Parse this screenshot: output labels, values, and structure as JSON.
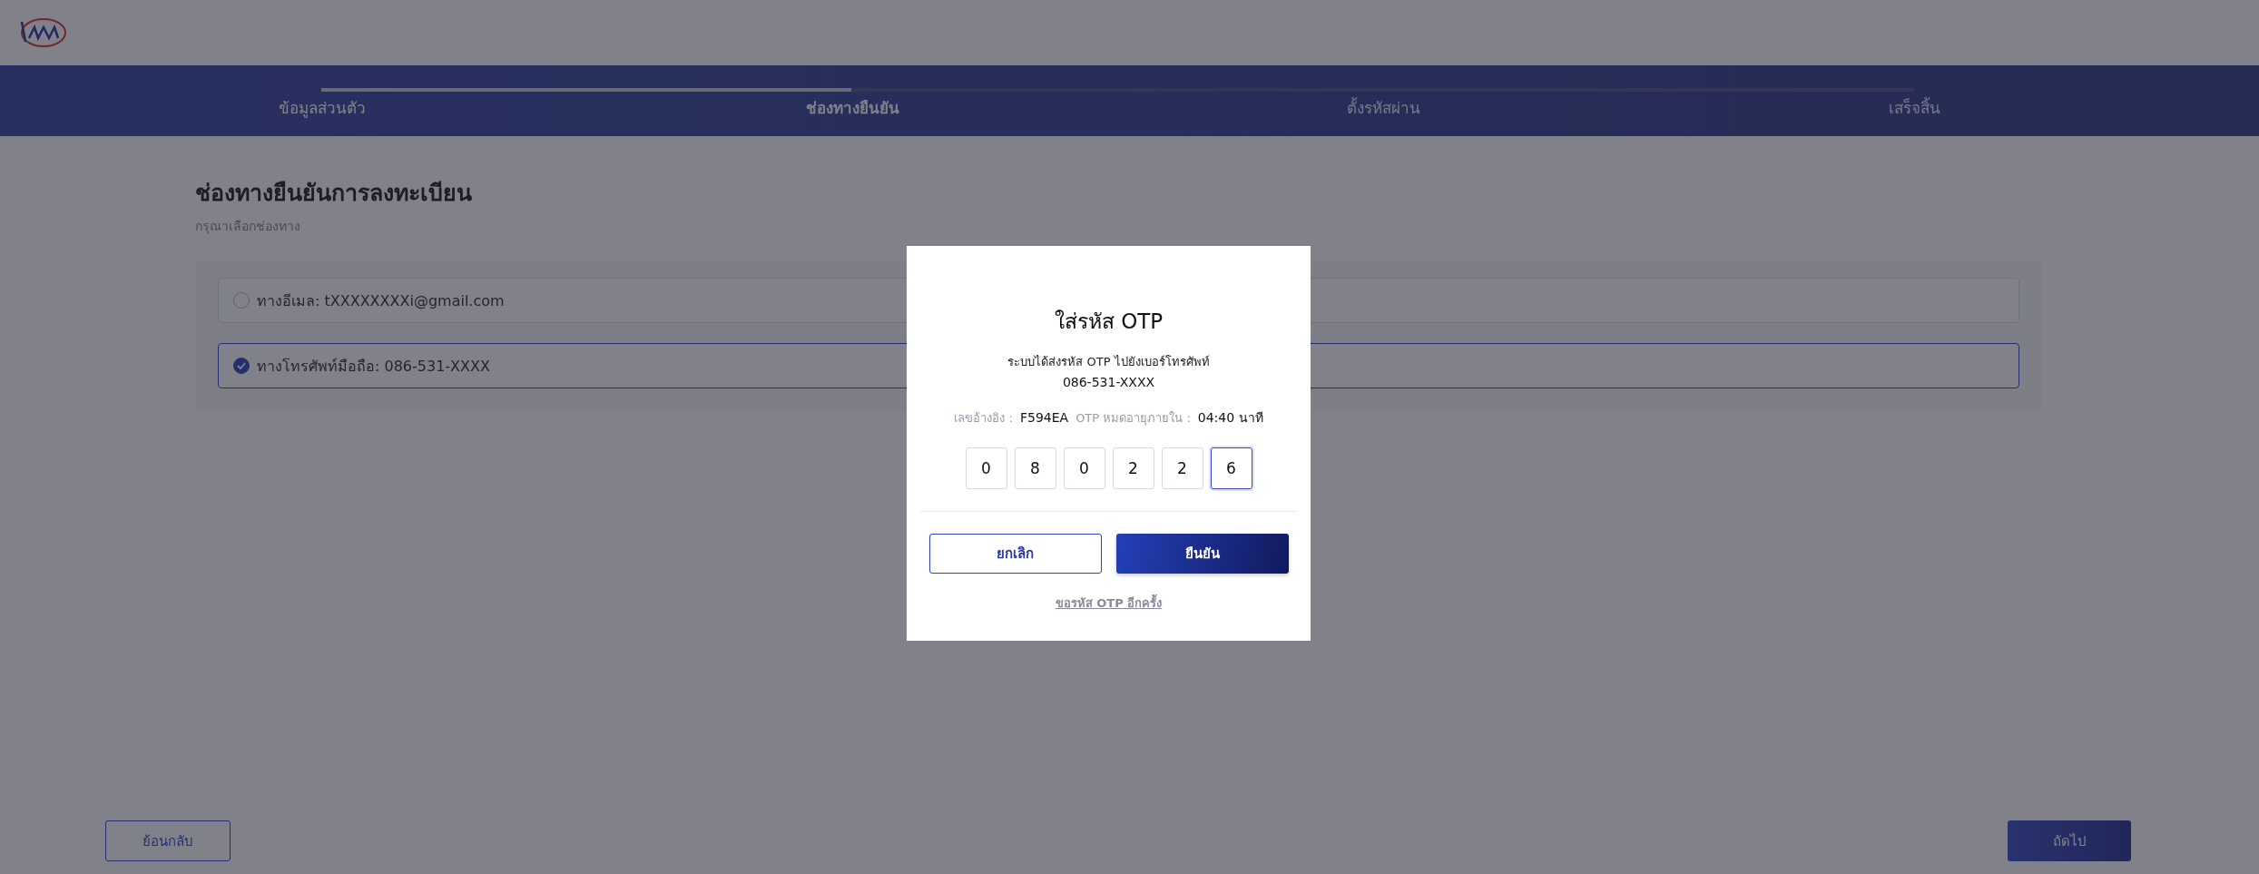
{
  "stepper": {
    "level": 0.333,
    "steps": [
      {
        "label": "ข้อมูลส่วนตัว",
        "completed": true,
        "selected": false
      },
      {
        "label": "ช่องทางยืนยัน",
        "completed": false,
        "selected": true
      },
      {
        "label": "ตั้งรหัสผ่าน",
        "completed": false,
        "selected": false
      },
      {
        "label": "เสร็จสิ้น",
        "completed": false,
        "selected": false
      }
    ]
  },
  "content": {
    "title": "ช่องทางยืนยันการลงทะเบียน",
    "subtitle": "กรุณาเลือกช่องทาง",
    "options": [
      {
        "label": "ทางอีเมล: tXXXXXXXXi@gmail.com",
        "selected": false
      },
      {
        "label": "ทางโทรศัพท์มือถือ: 086-531-XXXX",
        "selected": true
      }
    ]
  },
  "footer": {
    "back": "ย้อนกลับ",
    "next": "ถัดไป"
  },
  "modal": {
    "title": "ใส่รหัส OTP",
    "message": "ระบบได้ส่งรหัส OTP ไปยังเบอร์โทรศัพท์",
    "phone": "086-531-XXXX",
    "ref_label": "เลขอ้างอิง :",
    "ref_value": "F594EA",
    "expiry_label": "OTP หมดอายุภายใน :",
    "expiry_value": "04:40 นาที",
    "digits": [
      {
        "value": "0",
        "selected": false
      },
      {
        "value": "8",
        "selected": false
      },
      {
        "value": "0",
        "selected": false
      },
      {
        "value": "2",
        "selected": false
      },
      {
        "value": "2",
        "selected": false
      },
      {
        "value": "6",
        "selected": true
      }
    ],
    "cancel": "ยกเลิก",
    "confirm": "ยืนยัน",
    "resend": "ขอรหัส OTP อีกครั้ง"
  }
}
